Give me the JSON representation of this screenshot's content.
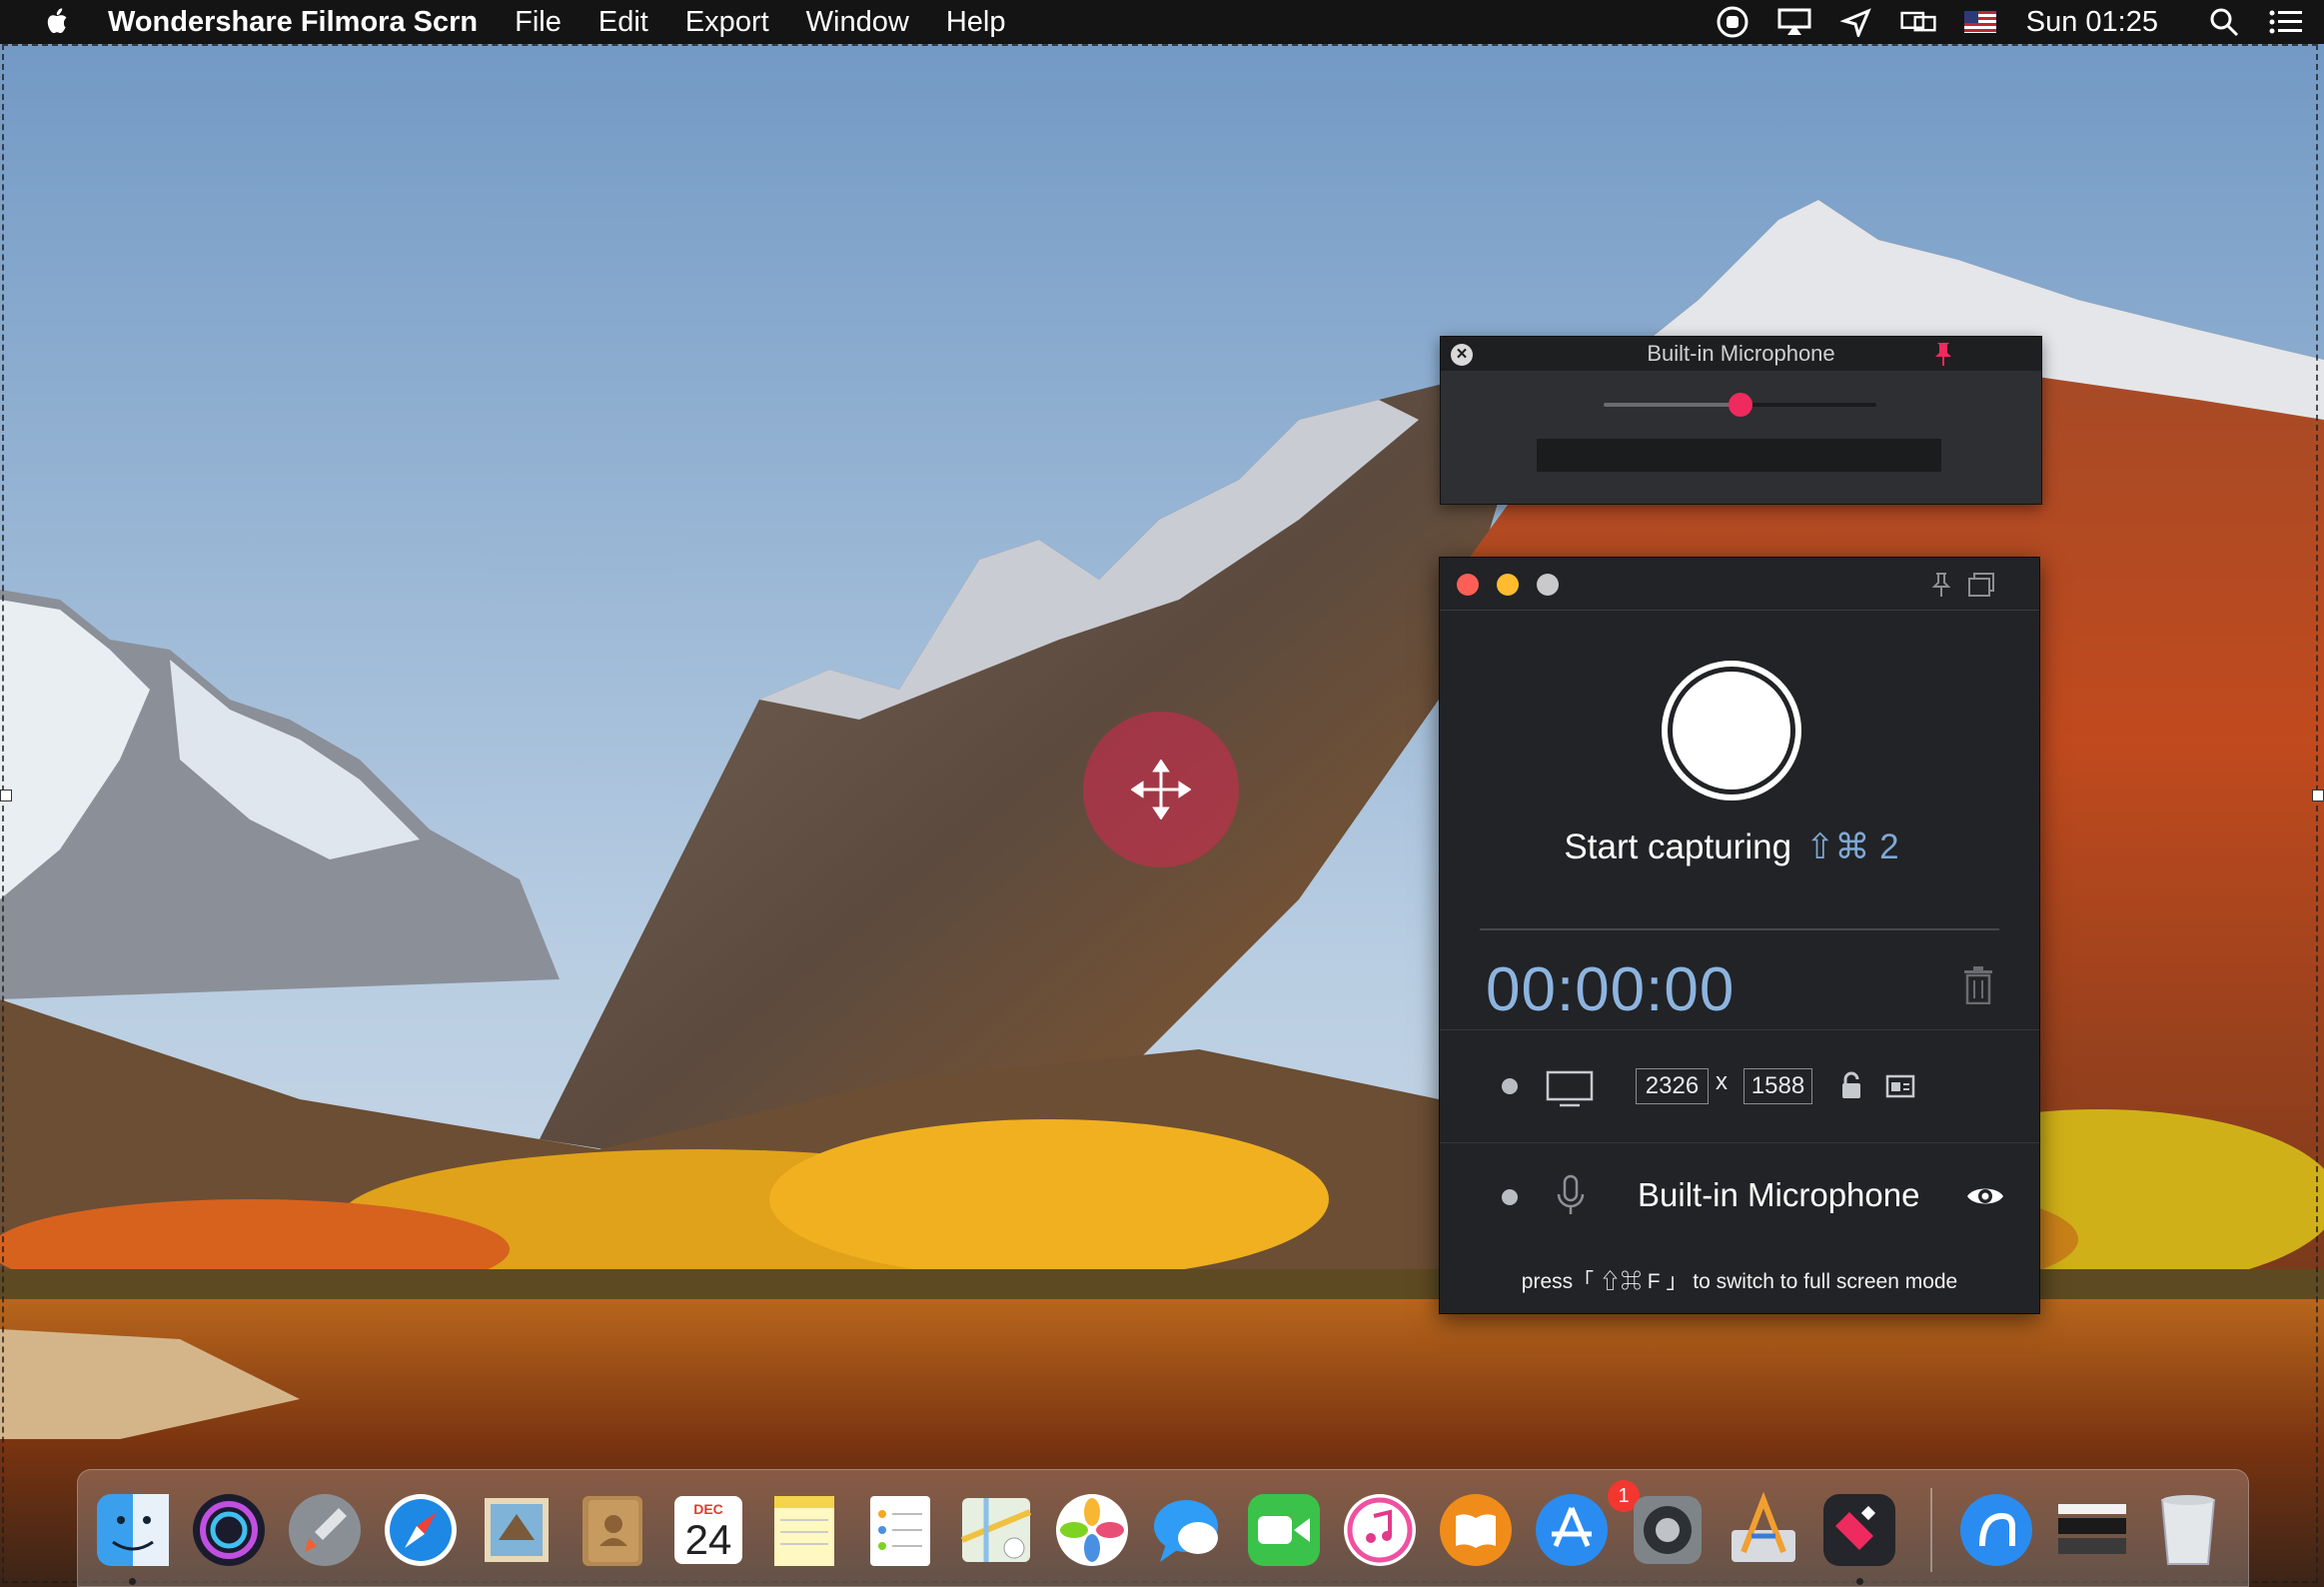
{
  "menubar": {
    "app_name": "Wondershare Filmora Scrn",
    "menus": [
      "File",
      "Edit",
      "Export",
      "Window",
      "Help"
    ],
    "clock": "Sun 01:25",
    "status_icons": [
      "record-stop-icon",
      "airplay-icon",
      "location-icon",
      "display-mirror-icon",
      "us-flag-icon",
      "spotlight-icon",
      "notification-center-icon"
    ]
  },
  "mic_window": {
    "title": "Built-in Microphone",
    "volume_level": 0.5
  },
  "recorder": {
    "start_label": "Start capturing",
    "start_shortcut": "⇧⌘ 2",
    "timer": "00:00:00",
    "width": "2326",
    "height": "1588",
    "dim_separator": "x",
    "mic_label": "Built-in Microphone",
    "hint": "press「 ⇧⌘ F 」 to switch to full screen mode"
  },
  "dock": {
    "calendar_month": "DEC",
    "calendar_day": "24",
    "app_store_badge": "1",
    "apps": [
      "Finder",
      "Siri",
      "Launchpad",
      "Safari",
      "Mail",
      "Contacts",
      "Calendar",
      "Notes",
      "Reminders",
      "Maps",
      "Photos",
      "Messages",
      "FaceTime",
      "iTunes",
      "iBooks",
      "App Store",
      "System Preferences",
      "Xcode Instruments",
      "Filmora Scrn",
      "Downloads",
      "Stack",
      "Trash"
    ]
  },
  "colors": {
    "record_accent": "#ef2a5e",
    "timer_blue": "#8db4df",
    "panel_bg": "#222326"
  }
}
